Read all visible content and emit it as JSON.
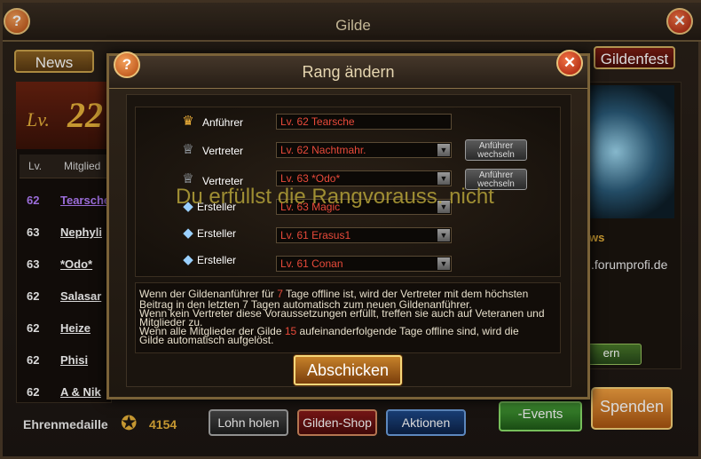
{
  "window": {
    "title": "Gilde"
  },
  "tabs": {
    "news": "News",
    "festival": "Gildenfest"
  },
  "level": {
    "label": "Lv.",
    "value": "22"
  },
  "members": {
    "headers": {
      "level": "Lv.",
      "member": "Mitglied"
    },
    "rows": [
      {
        "level": "62",
        "name": "Tearsche",
        "color": "#b680ff"
      },
      {
        "level": "63",
        "name": "Nephyli",
        "color": "#ffffff"
      },
      {
        "level": "63",
        "name": "*Odo*",
        "color": "#ffffff"
      },
      {
        "level": "62",
        "name": "Salasar",
        "color": "#ffffff"
      },
      {
        "level": "62",
        "name": "Heize",
        "color": "#ffffff"
      },
      {
        "level": "62",
        "name": "Phisi",
        "color": "#ffffff"
      },
      {
        "level": "62",
        "name": "A & Nik",
        "color": "#ffffff"
      }
    ]
  },
  "footer": {
    "medal_label": "Ehrenmedaille",
    "medal_value": "4154",
    "buttons": {
      "salary": "Lohn holen",
      "shop": "Gilden-Shop",
      "actions": "Aktionen"
    }
  },
  "right": {
    "news_label": "ws",
    "forum": ".forumprofi.de",
    "small_button": "ern",
    "events_button": "-Events",
    "donate_button": "Spenden"
  },
  "modal": {
    "title": "Rang ändern",
    "ranks": [
      {
        "label": "Anführer",
        "icon": "crown-icon",
        "value": "Lv. 62 Tearsche",
        "dropdown": false
      },
      {
        "label": "Vertreter",
        "icon": "wings-icon",
        "value": "Lv. 62 Nachtmahr.",
        "dropdown": true,
        "button": "Anführer wechseln"
      },
      {
        "label": "Vertreter",
        "icon": "wings-icon",
        "value": "Lv. 63 *Odo*",
        "dropdown": true,
        "button": "Anführer wechseln"
      },
      {
        "label": "Ersteller",
        "icon": "gem-icon",
        "value": "Lv. 63 Magic",
        "dropdown": true
      },
      {
        "label": "Ersteller",
        "icon": "gem-icon",
        "value": "Lv. 61 Erasus1",
        "dropdown": true
      },
      {
        "label": "Ersteller",
        "icon": "gem-icon",
        "value": "Lv. 61 Conan",
        "dropdown": true
      }
    ],
    "warning": "Du erfüllst die Rangvorauss. nicht",
    "info": {
      "l1a": "Wenn der Gildenanführer für ",
      "l1b": "7",
      "l1c": " Tage offline ist, wird der Vertreter mit dem höchsten",
      "l2": "Beitrag in den letzten 7 Tagen automatisch zum neuen Gildenanführer.",
      "l3": "Wenn kein Vertreter diese Voraussetzungen erfüllt, treffen sie auch auf Veteranen und",
      "l4": "Mitglieder zu.",
      "l5a": "Wenn alle Mitglieder der Gilde ",
      "l5b": "15",
      "l5c": " aufeinanderfolgende Tage offline sind, wird die",
      "l6": "Gilde automatisch aufgelöst."
    },
    "submit": "Abschicken"
  }
}
